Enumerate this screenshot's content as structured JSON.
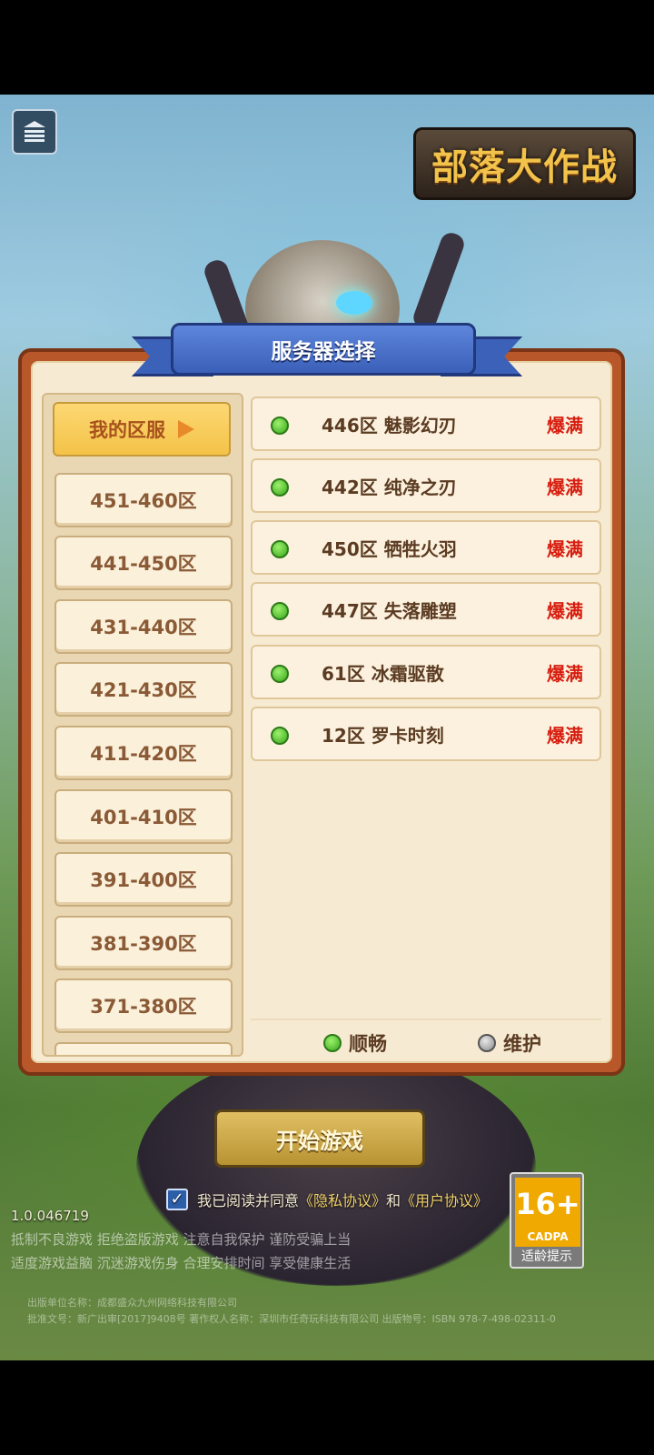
{
  "game": {
    "logo_text": "部落大作战"
  },
  "dialog": {
    "title": "服务器选择",
    "my_zone": "我的区服",
    "ranges": [
      "451-460区",
      "441-450区",
      "431-440区",
      "421-430区",
      "411-420区",
      "401-410区",
      "391-400区",
      "381-390区",
      "371-380区"
    ],
    "servers": [
      {
        "name": "446区 魅影幻刃",
        "status": "爆满"
      },
      {
        "name": "442区 纯净之刃",
        "status": "爆满"
      },
      {
        "name": "450区 牺牲火羽",
        "status": "爆满"
      },
      {
        "name": "447区 失落雕塑",
        "status": "爆满"
      },
      {
        "name": "61区 冰霜驱散",
        "status": "爆满"
      },
      {
        "name": "12区 罗卡时刻",
        "status": "爆满"
      }
    ],
    "legend": {
      "smooth": "顺畅",
      "maintenance": "维护"
    }
  },
  "start_button": "开始游戏",
  "agreement": {
    "checked": true,
    "prefix": "我已阅读并同意",
    "privacy": "《隐私协议》",
    "and": "和",
    "user": "《用户协议》"
  },
  "age_rating": {
    "age": "16+",
    "org": "CADPA",
    "tip": "适龄提示"
  },
  "version": "1.0.046719",
  "health_notice": [
    "抵制不良游戏 拒绝盗版游戏 注意自我保护 谨防受骗上当",
    "适度游戏益脑 沉迷游戏伤身 合理安排时间 享受健康生活"
  ],
  "publisher_lines": [
    "出版单位名称：成都盛众九州网络科技有限公司",
    "批准文号：新广出审[2017]9408号  著作权人名称：深圳市任奇玩科技有限公司  出版物号：ISBN 978-7-498-02311-0"
  ],
  "colors": {
    "full": "#d81e10",
    "smooth": "#3aa81c",
    "maintenance": "#8a8a8a"
  }
}
